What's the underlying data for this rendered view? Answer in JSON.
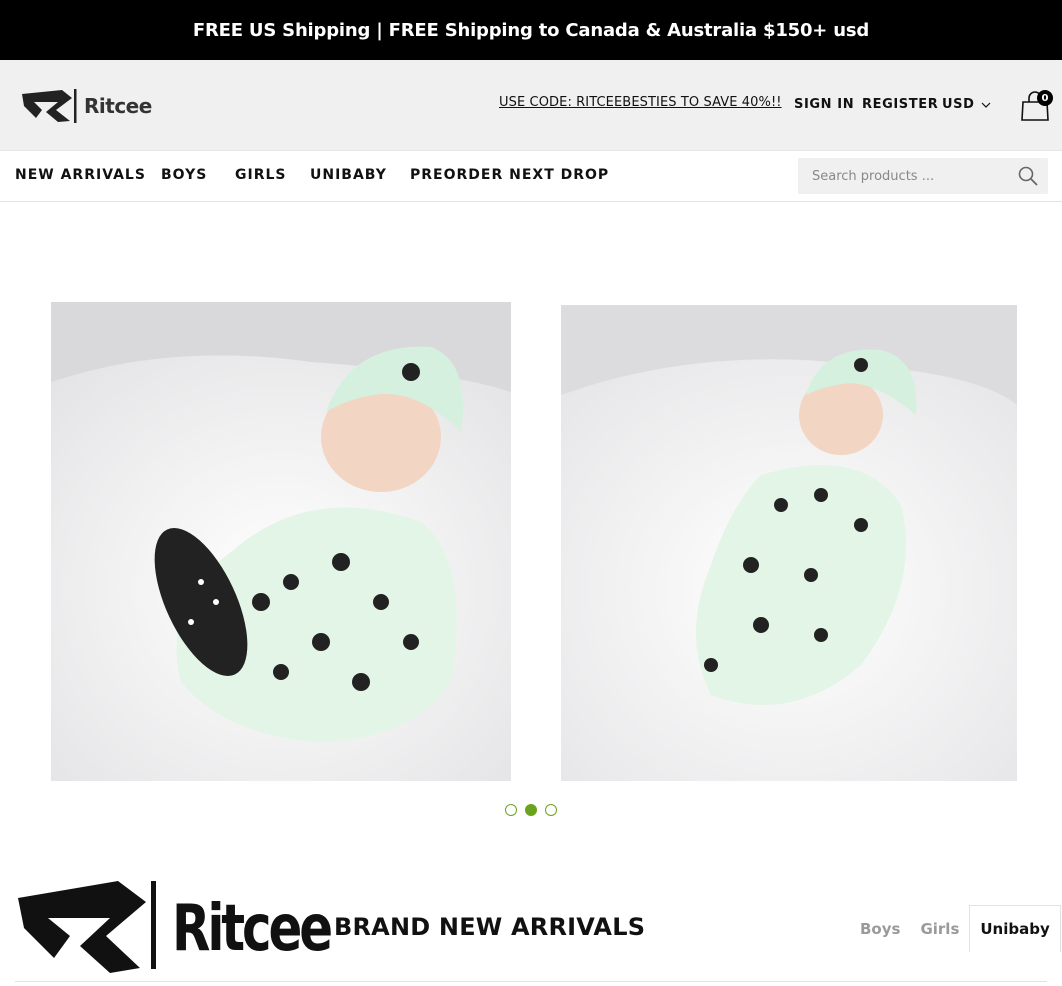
{
  "announcement": "FREE US Shipping | FREE Shipping to Canada & Australia $150+ usd",
  "header": {
    "brand": "Ritcee",
    "promo": "USE CODE: RITCEEBESTIES TO SAVE 40%!!",
    "sign_in": "SIGN IN",
    "register": "REGISTER",
    "currency": "USD",
    "cart_count": "0"
  },
  "nav": {
    "items": [
      "NEW ARRIVALS",
      "BOYS",
      "GIRLS",
      "UNIBABY",
      "PREORDER NEXT DROP"
    ],
    "search_placeholder": "Search products ..."
  },
  "slider": {
    "slides": [
      "baby-panda-onesie-photo-1",
      "baby-panda-onesie-photo-2"
    ],
    "dot_count": 3,
    "active_dot": 2
  },
  "section": {
    "brand": "Ritcee",
    "title": "BRAND NEW ARRIVALS",
    "tabs": [
      "Boys",
      "Girls",
      "Unibaby"
    ],
    "active_tab": "Unibaby"
  },
  "colors": {
    "accent": "#6aa31e",
    "topbar_bg": "#000000",
    "header_bg": "#f0f0f0"
  }
}
